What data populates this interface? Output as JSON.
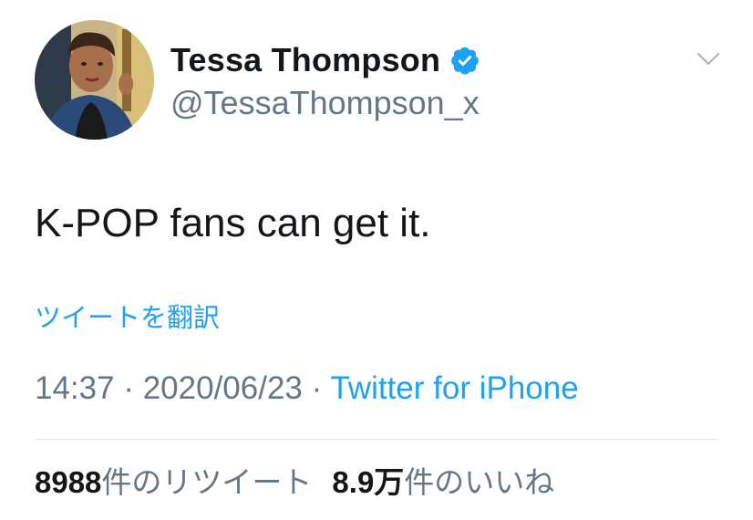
{
  "author": {
    "display_name": "Tessa Thompson",
    "handle": "@TessaThompson_x",
    "verified_icon": "verified-badge-icon",
    "avatar": "profile-avatar"
  },
  "menu": {
    "icon": "chevron-down-icon"
  },
  "tweet": {
    "text": "K-POP fans can get it.",
    "translate_label": "ツイートを翻訳"
  },
  "meta": {
    "time": "14:37",
    "separator": " · ",
    "date": "2020/06/23",
    "source": "Twitter for iPhone"
  },
  "stats": {
    "retweets_count": "8988",
    "retweets_label": "件のリツイート",
    "likes_count": "8.9万",
    "likes_label": "件のいいね"
  },
  "colors": {
    "link": "#1da1f2",
    "secondary_text": "#657786",
    "primary_text": "#14171a",
    "divider": "#e1e8ed"
  }
}
